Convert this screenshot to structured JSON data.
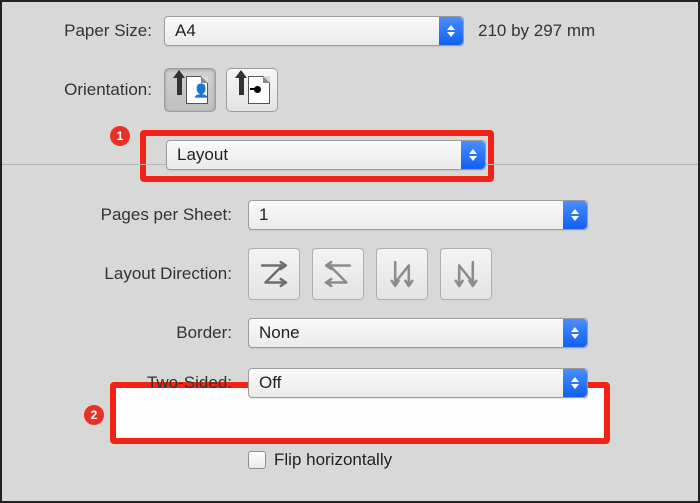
{
  "labels": {
    "paper_size": "Paper Size:",
    "orientation": "Orientation:",
    "pages_per_sheet": "Pages per Sheet:",
    "layout_direction": "Layout Direction:",
    "border": "Border:",
    "two_sided": "Two-Sided:",
    "flip_horizontally": "Flip horizontally"
  },
  "paper_size": {
    "value": "A4",
    "dimensions": "210 by 297 mm"
  },
  "section_dropdown": {
    "value": "Layout"
  },
  "pages_per_sheet": {
    "value": "1"
  },
  "border": {
    "value": "None"
  },
  "two_sided": {
    "value": "Off"
  },
  "annotations": {
    "badge1": "1",
    "badge2": "2"
  }
}
